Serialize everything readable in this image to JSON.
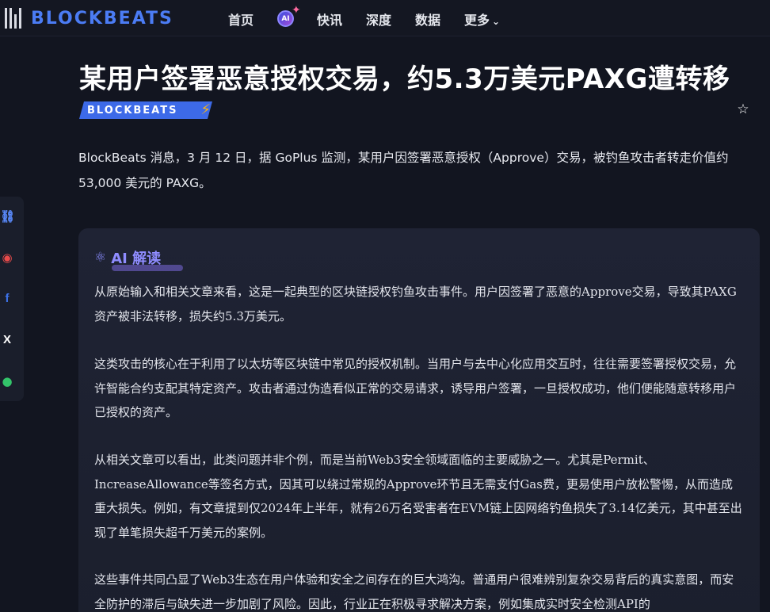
{
  "brand": {
    "name": "BLOCKBEATS",
    "colors": {
      "accent": "#4b7cf4",
      "bg": "#121520",
      "ai": "#8f8cff",
      "bolt": "#f5b21b"
    }
  },
  "nav": {
    "items": [
      "首页",
      "快讯",
      "深度",
      "数据",
      "更多"
    ],
    "ai_badge": "AI"
  },
  "article": {
    "title": "某用户签署恶意授权交易，约5.3万美元PAXG遭转移",
    "source_tag": "BLOCKBEATS",
    "favorite_icon": "star-outline-icon",
    "lead": "BlockBeats 消息，3 月 12 日，据 GoPlus 监测，某用户因签署恶意授权（Approve）交易，被钓鱼攻击者转走价值约 53,000 美元的 PAXG。"
  },
  "share": {
    "icons": [
      "link-icon",
      "weibo-icon",
      "facebook-icon",
      "x-icon",
      "wechat-icon"
    ]
  },
  "ai_card": {
    "heading": "AI 解读",
    "paragraphs": [
      "从原始输入和相关文章来看，这是一起典型的区块链授权钓鱼攻击事件。用户因签署了恶意的Approve交易，导致其PAXG资产被非法转移，损失约5.3万美元。",
      "这类攻击的核心在于利用了以太坊等区块链中常见的授权机制。当用户与去中心化应用交互时，往往需要签署授权交易，允许智能合约支配其特定资产。攻击者通过伪造看似正常的交易请求，诱导用户签署，一旦授权成功，他们便能随意转移用户已授权的资产。",
      "从相关文章可以看出，此类问题并非个例，而是当前Web3安全领域面临的主要威胁之一。尤其是Permit、IncreaseAllowance等签名方式，因其可以绕过常规的Approve环节且无需支付Gas费，更易使用户放松警惕，从而造成重大损失。例如，有文章提到仅2024年上半年，就有26万名受害者在EVM链上因网络钓鱼损失了3.14亿美元，其中甚至出现了单笔损失超千万美元的案例。",
      "这些事件共同凸显了Web3生态在用户体验和安全之间存在的巨大鸿沟。普通用户很难辨别复杂交易背后的真实意图，而安全防护的滞后与缺失进一步加剧了风险。因此，行业正在积极寻求解决方案，例如集成实时安全检测API的"
    ]
  }
}
